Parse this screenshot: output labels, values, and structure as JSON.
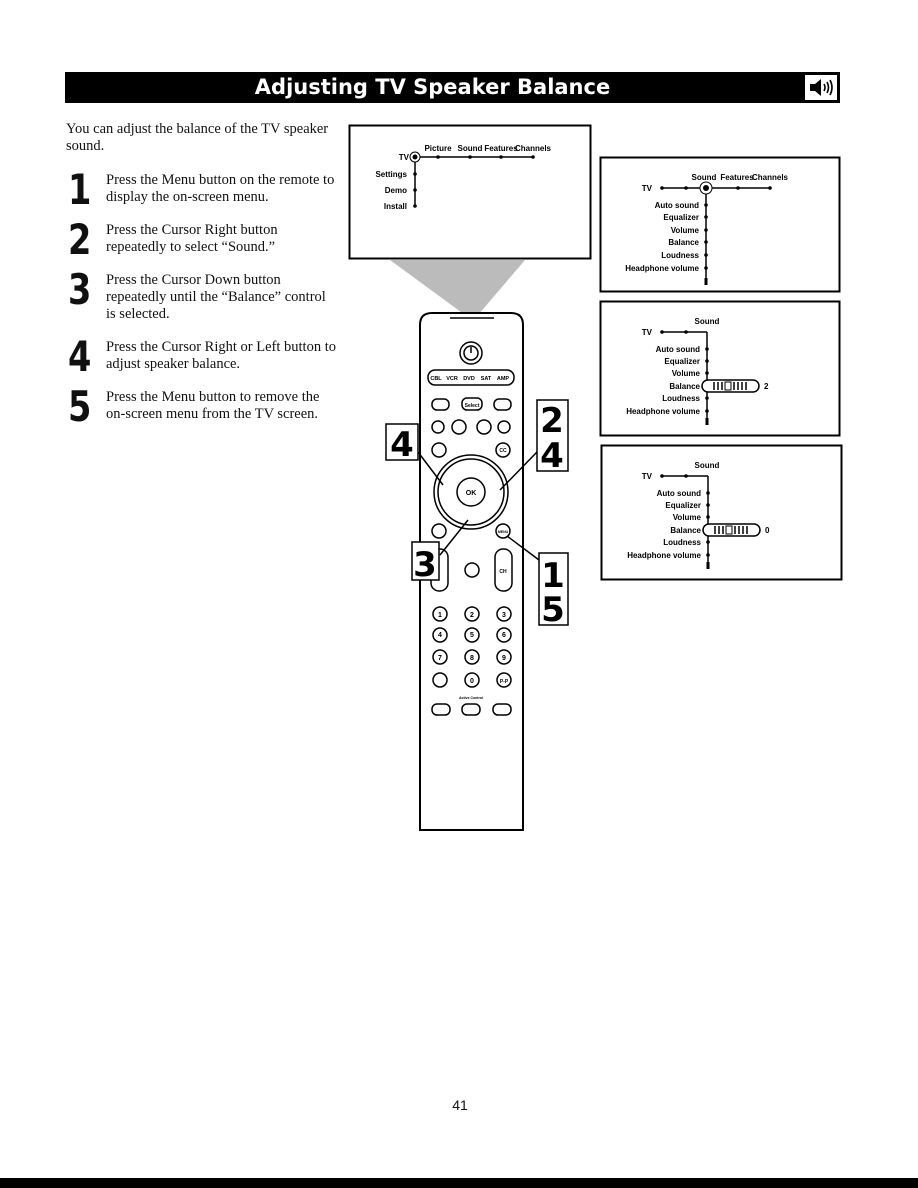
{
  "header": {
    "title": "Adjusting TV Speaker Balance",
    "icon": "speaker-icon"
  },
  "intro": "You can adjust the balance of the TV speaker sound.",
  "steps": [
    {
      "num": "1",
      "text": "Press the Menu button on the remote to display the on-screen menu."
    },
    {
      "num": "2",
      "text": "Press the Cursor Right button repeatedly to select “Sound.”"
    },
    {
      "num": "3",
      "text": "Press the Cursor Down button repeatedly until the “Balance” control is selected."
    },
    {
      "num": "4",
      "text": "Press the Cursor Right or Left button to adjust speaker balance."
    },
    {
      "num": "5",
      "text": "Press the Menu button to remove the on-screen menu from the TV screen."
    }
  ],
  "menu1": {
    "root": "TV",
    "top": [
      "Picture",
      "Sound",
      "Features",
      "Channels"
    ],
    "items": [
      "Settings",
      "Demo",
      "Install"
    ]
  },
  "menu2": {
    "root": "TV",
    "top": [
      "Sound",
      "Features",
      "Channels"
    ],
    "items": [
      "Auto sound",
      "Equalizer",
      "Volume",
      "Balance",
      "Loudness",
      "Headphone volume"
    ]
  },
  "menu3": {
    "root": "TV",
    "title": "Sound",
    "items": [
      "Auto sound",
      "Equalizer",
      "Volume",
      "Balance",
      "Loudness",
      "Headphone volume"
    ],
    "balance_value": "2"
  },
  "menu4": {
    "root": "TV",
    "title": "Sound",
    "items": [
      "Auto sound",
      "Equalizer",
      "Volume",
      "Balance",
      "Loudness",
      "Headphone volume"
    ],
    "balance_value": "0"
  },
  "remote": {
    "sources": [
      "CBL",
      "VCR",
      "DVD",
      "SAT",
      "AMP"
    ],
    "select": "Select",
    "ok": "OK",
    "cc": "CC",
    "menu": "MENU",
    "ch": "CH",
    "digits": [
      "1",
      "2",
      "3",
      "4",
      "5",
      "6",
      "7",
      "8",
      "9"
    ],
    "zero": "0",
    "pp": "P-P",
    "active_control": "Active Control"
  },
  "callouts": {
    "left": "4",
    "right_top": "2",
    "right_bottom": "4",
    "down": "3",
    "menu_top": "1",
    "menu_bottom": "5"
  },
  "page_number": "41"
}
